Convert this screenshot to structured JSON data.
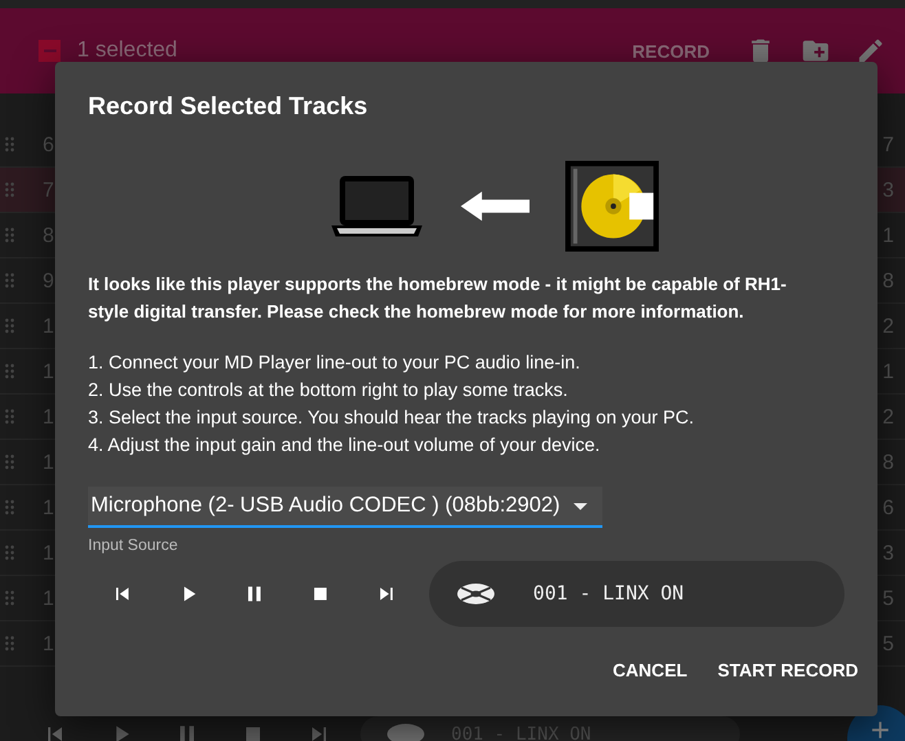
{
  "app_bar": {
    "select_all_checked": true,
    "selection_label": "1 selected",
    "action": "RECORD"
  },
  "tracks": [
    {
      "index": "6",
      "duration": "7",
      "selected": false
    },
    {
      "index": "7",
      "duration": "3",
      "selected": true
    },
    {
      "index": "8",
      "duration": "1",
      "selected": false
    },
    {
      "index": "9",
      "duration": "8",
      "selected": false
    },
    {
      "index": "1",
      "duration": "2",
      "selected": false
    },
    {
      "index": "1",
      "duration": "1",
      "selected": false
    },
    {
      "index": "1",
      "duration": "2",
      "selected": false
    },
    {
      "index": "1",
      "duration": "8",
      "selected": false
    },
    {
      "index": "1",
      "duration": "6",
      "selected": false
    },
    {
      "index": "1",
      "duration": "3",
      "selected": false
    },
    {
      "index": "1",
      "duration": "5",
      "selected": false
    },
    {
      "index": "1",
      "duration": "5",
      "selected": false
    }
  ],
  "player_bar": {
    "track": "001 - LINX ON"
  },
  "dialog": {
    "title": "Record Selected Tracks",
    "notice": "It looks like this player supports the homebrew mode - it might be capable of RH1-style digital transfer. Please check the homebrew mode for more information.",
    "steps": [
      "1. Connect your MD Player line-out to your PC audio line-in.",
      "2. Use the controls at the bottom right to play some tracks.",
      "3. Select the input source. You should hear the tracks playing on your PC.",
      "4. Adjust the input gain and the line-out volume of your device."
    ],
    "input_source": {
      "value": "Microphone (2- USB Audio CODEC ) (08bb:2902)",
      "label": "Input Source"
    },
    "player": {
      "track": "001 - LINX ON"
    },
    "buttons": [
      "CANCEL",
      "START RECORD"
    ]
  }
}
